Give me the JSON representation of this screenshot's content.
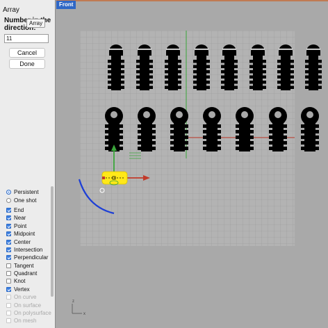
{
  "panel": {
    "title": "Array",
    "prompt": "Number in the direction:",
    "tooltip": "Array",
    "count_value": "11",
    "cancel_label": "Cancel",
    "done_label": "Done"
  },
  "viewport": {
    "tab_label": "Front",
    "axis_z": "z",
    "axis_x": "x"
  },
  "osnap": {
    "modes": [
      {
        "label": "Persistent",
        "selected": true
      },
      {
        "label": "One shot",
        "selected": false
      }
    ],
    "items": [
      {
        "label": "End",
        "checked": true,
        "enabled": true
      },
      {
        "label": "Near",
        "checked": true,
        "enabled": true
      },
      {
        "label": "Point",
        "checked": true,
        "enabled": true
      },
      {
        "label": "Midpoint",
        "checked": true,
        "enabled": true
      },
      {
        "label": "Center",
        "checked": true,
        "enabled": true
      },
      {
        "label": "Intersection",
        "checked": true,
        "enabled": true
      },
      {
        "label": "Perpendicular",
        "checked": true,
        "enabled": true
      },
      {
        "label": "Tangent",
        "checked": false,
        "enabled": true
      },
      {
        "label": "Quadrant",
        "checked": false,
        "enabled": true
      },
      {
        "label": "Knot",
        "checked": false,
        "enabled": true
      },
      {
        "label": "Vertex",
        "checked": true,
        "enabled": true
      },
      {
        "label": "On curve",
        "checked": false,
        "enabled": false
      },
      {
        "label": "On surface",
        "checked": false,
        "enabled": false
      },
      {
        "label": "On polysurface",
        "checked": false,
        "enabled": false
      },
      {
        "label": "On mesh",
        "checked": false,
        "enabled": false
      }
    ]
  },
  "colors": {
    "panel_bg": "#ececec",
    "viewport_bg": "#a9a9a9",
    "grid_bg": "#b3b3b3",
    "grid_line": "#989898",
    "tab_blue": "#2f67c6",
    "y_axis": "#3aa63a",
    "x_axis": "#c23a2a",
    "gumball_yellow": "#ffe819",
    "curve_blue": "#1d3fd6",
    "shape_black": "#000000",
    "checkbox_blue": "#3c7fe0"
  },
  "scene": {
    "top_row_count": 8,
    "bottom_row_count": 7
  }
}
